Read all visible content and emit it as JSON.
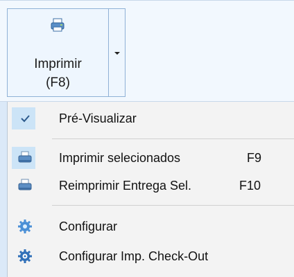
{
  "ribbon": {
    "print_button": {
      "label_line1": "Imprimir",
      "label_line2": "(F8)",
      "icon": "printer-icon"
    },
    "dropdown_arrow_icon": "chevron-down-icon"
  },
  "menu": {
    "items": [
      {
        "label": "Pré-Visualizar",
        "checked": true,
        "icon": "check-icon",
        "shortcut": ""
      },
      {
        "label": "Imprimir selecionados",
        "shortcut": "F9",
        "icon": "printer-icon"
      },
      {
        "label": "Reimprimir Entrega Sel.",
        "shortcut": "F10",
        "icon": "printer-icon"
      },
      {
        "label": "Configurar",
        "shortcut": "",
        "icon": "gear-icon"
      },
      {
        "label": "Configurar Imp. Check-Out",
        "shortcut": "",
        "icon": "gear-icon"
      }
    ]
  },
  "colors": {
    "accent": "#cce4f7",
    "border": "#8fb1d6",
    "menu_bg": "#f3f3f3"
  }
}
